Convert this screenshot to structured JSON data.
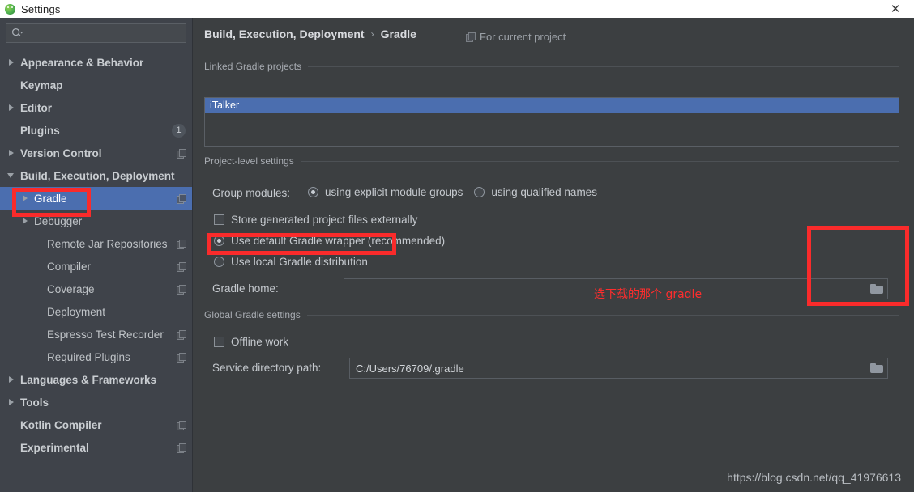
{
  "window": {
    "title": "Settings",
    "app_icon": "android-studio-icon",
    "close_label": "✕"
  },
  "search": {
    "placeholder": "",
    "value": "",
    "icon": "search-icon"
  },
  "sidebar": {
    "items": [
      {
        "label": "Appearance & Behavior",
        "level": 0,
        "arrow": "closed",
        "bold": true,
        "badge": null,
        "copy": false,
        "selected": false
      },
      {
        "label": "Keymap",
        "level": 0,
        "arrow": "none",
        "bold": true,
        "badge": null,
        "copy": false,
        "selected": false
      },
      {
        "label": "Editor",
        "level": 0,
        "arrow": "closed",
        "bold": true,
        "badge": null,
        "copy": false,
        "selected": false
      },
      {
        "label": "Plugins",
        "level": 0,
        "arrow": "none",
        "bold": true,
        "badge": "1",
        "copy": false,
        "selected": false
      },
      {
        "label": "Version Control",
        "level": 0,
        "arrow": "closed",
        "bold": true,
        "badge": null,
        "copy": true,
        "selected": false
      },
      {
        "label": "Build, Execution, Deployment",
        "level": 0,
        "arrow": "open",
        "bold": true,
        "badge": null,
        "copy": false,
        "selected": false
      },
      {
        "label": "Gradle",
        "level": 1,
        "arrow": "closed",
        "bold": false,
        "badge": null,
        "copy": true,
        "selected": true
      },
      {
        "label": "Debugger",
        "level": 1,
        "arrow": "closed",
        "bold": false,
        "badge": null,
        "copy": false,
        "selected": false
      },
      {
        "label": "Remote Jar Repositories",
        "level": 2,
        "arrow": "none",
        "bold": false,
        "badge": null,
        "copy": true,
        "selected": false
      },
      {
        "label": "Compiler",
        "level": 2,
        "arrow": "none",
        "bold": false,
        "badge": null,
        "copy": true,
        "selected": false
      },
      {
        "label": "Coverage",
        "level": 2,
        "arrow": "none",
        "bold": false,
        "badge": null,
        "copy": true,
        "selected": false
      },
      {
        "label": "Deployment",
        "level": 2,
        "arrow": "none",
        "bold": false,
        "badge": null,
        "copy": false,
        "selected": false
      },
      {
        "label": "Espresso Test Recorder",
        "level": 2,
        "arrow": "none",
        "bold": false,
        "badge": null,
        "copy": true,
        "selected": false
      },
      {
        "label": "Required Plugins",
        "level": 2,
        "arrow": "none",
        "bold": false,
        "badge": null,
        "copy": true,
        "selected": false
      },
      {
        "label": "Languages & Frameworks",
        "level": 0,
        "arrow": "closed",
        "bold": true,
        "badge": null,
        "copy": false,
        "selected": false
      },
      {
        "label": "Tools",
        "level": 0,
        "arrow": "closed",
        "bold": true,
        "badge": null,
        "copy": false,
        "selected": false
      },
      {
        "label": "Kotlin Compiler",
        "level": 0,
        "arrow": "none",
        "bold": true,
        "badge": null,
        "copy": true,
        "selected": false
      },
      {
        "label": "Experimental",
        "level": 0,
        "arrow": "none",
        "bold": true,
        "badge": null,
        "copy": true,
        "selected": false
      }
    ]
  },
  "main": {
    "breadcrumb": {
      "parent": "Build, Execution, Deployment",
      "separator": "›",
      "current": "Gradle"
    },
    "scope_note": "For current project",
    "sections": {
      "linked": "Linked Gradle projects",
      "project_level": "Project-level settings",
      "global": "Global Gradle settings"
    },
    "linked_projects": [
      {
        "name": "iTalker",
        "selected": true
      }
    ],
    "group_modules": {
      "label": "Group modules:",
      "options": [
        {
          "label": "using explicit module groups",
          "checked": true
        },
        {
          "label": "using qualified names",
          "checked": false
        }
      ]
    },
    "store_externally": {
      "label": "Store generated project files externally",
      "checked": false
    },
    "distribution": {
      "options": [
        {
          "label": "Use default Gradle wrapper (recommended)",
          "checked": true
        },
        {
          "label": "Use local Gradle distribution",
          "checked": false
        }
      ]
    },
    "gradle_home": {
      "label": "Gradle home:",
      "value": "",
      "placeholder": "",
      "browse_icon": "folder-icon"
    },
    "offline_work": {
      "label": "Offline work",
      "checked": false
    },
    "service_directory": {
      "label": "Service directory path:",
      "value": "C:/Users/76709/.gradle",
      "browse_icon": "folder-icon"
    }
  },
  "annotations": {
    "chinese_note": "选下载的那个 gradle",
    "highlight_color": "#fa2b2b",
    "boxes": [
      {
        "name": "gradle-sidebar-highlight"
      },
      {
        "name": "use-local-gradle-highlight"
      },
      {
        "name": "browse-button-highlight"
      }
    ]
  },
  "watermark": "https://blog.csdn.net/qq_41976613"
}
